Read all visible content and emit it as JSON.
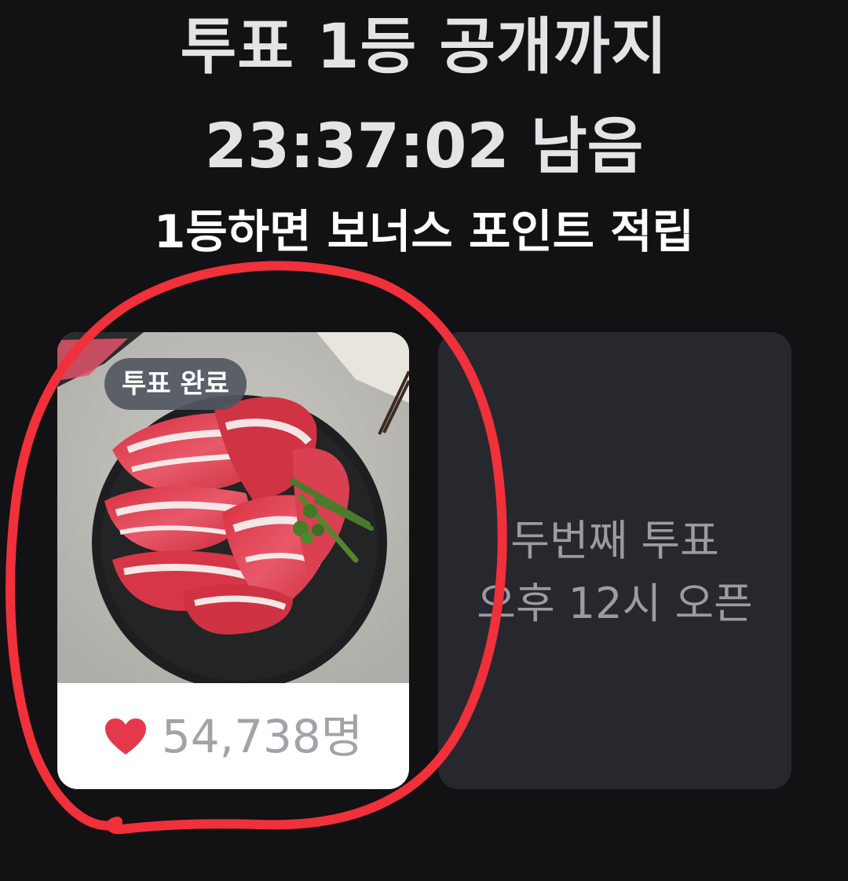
{
  "header": {
    "title": "투표 1등 공개까지",
    "countdown": "23:37:02 남음",
    "bonus": "1등하면 보너스 포인트 적립"
  },
  "vote_card": {
    "badge": "투표 완료",
    "heart_icon": "heart-icon",
    "vote_count": "54,738명",
    "photo_subject": "sliced marbled beef on black plate"
  },
  "locked_card": {
    "line1": "두번째 투표",
    "line2": "오후 12시 오픈"
  },
  "colors": {
    "background": "#121114",
    "heart": "#e5394b",
    "annotation": "#f0303a",
    "locked_card": "#27282e"
  }
}
